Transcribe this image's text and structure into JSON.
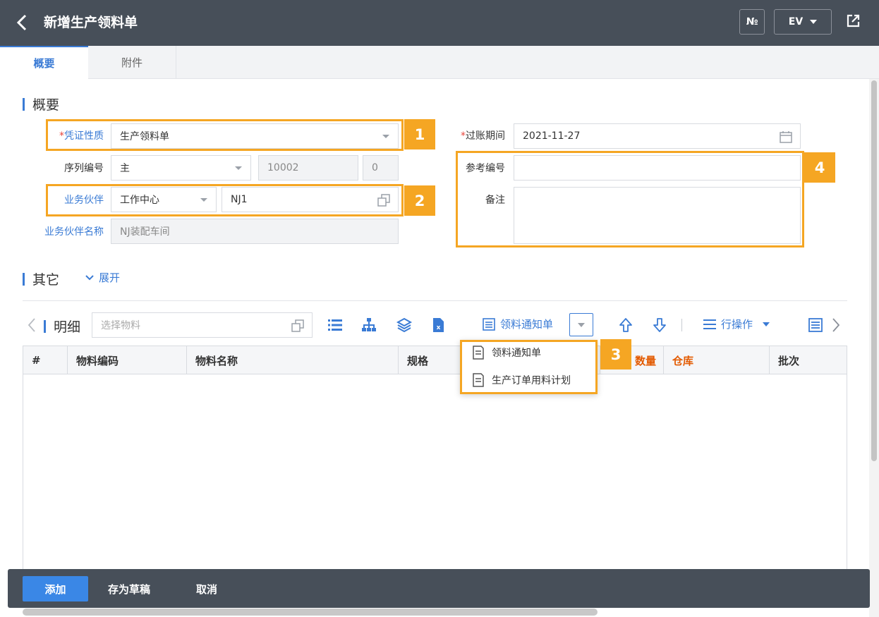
{
  "header": {
    "title": "新增生产领料单",
    "number_button": "№",
    "env_button": "EV"
  },
  "tabs": [
    {
      "label": "概要"
    },
    {
      "label": "附件"
    }
  ],
  "summary": {
    "section_title": "概要",
    "voucher_type": {
      "label": "凭证性质",
      "value": "生产领料单"
    },
    "serial_no": {
      "label": "序列编号",
      "series": "主",
      "number": "10002",
      "suffix": "0"
    },
    "partner": {
      "label": "业务伙伴",
      "type": "工作中心",
      "code": "NJ1"
    },
    "partner_name": {
      "label": "业务伙伴名称",
      "value": "NJ装配车间"
    },
    "posting_date": {
      "label": "过账期间",
      "value": "2021-11-27"
    },
    "reference_no": {
      "label": "参考编号",
      "value": ""
    },
    "remarks": {
      "label": "备注",
      "value": ""
    }
  },
  "other": {
    "section_title": "其它",
    "expand_label": "展开"
  },
  "detail": {
    "title": "明细",
    "search_placeholder": "选择物料",
    "notice_label": "领料通知单",
    "row_ops_label": "行操作",
    "columns": [
      "#",
      "物料编码",
      "物料名称",
      "规格",
      "数量",
      "仓库",
      "批次"
    ],
    "dropdown": [
      "领料通知单",
      "生产订单用料计划"
    ]
  },
  "annotations": [
    "1",
    "2",
    "3",
    "4"
  ],
  "footer": {
    "add": "添加",
    "save_draft": "存为草稿",
    "cancel": "取消"
  },
  "colors": {
    "header_bg": "#474f59",
    "accent": "#3a7bd5",
    "highlight": "#f5a623",
    "required": "#e8453c"
  }
}
